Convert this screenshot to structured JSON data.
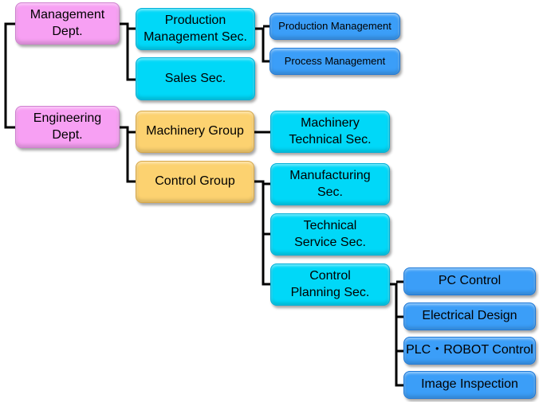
{
  "colors": {
    "department": "#f7a0f3",
    "section": "#00d8f8",
    "group": "#fcd270",
    "unit": "#3b9ef8",
    "connector": "#000000"
  },
  "departments": [
    {
      "label": "Management\nDept."
    },
    {
      "label": "Engineering\nDept."
    }
  ],
  "management": {
    "production_mgmt_sec": "Production\nManagement Sec.",
    "sales_sec": "Sales Sec.",
    "production_units": [
      "Production Management",
      "Process Management"
    ]
  },
  "engineering": {
    "machinery_group": "Machinery Group",
    "control_group": "Control Group",
    "machinery_technical_sec": "Machinery\nTechnical Sec.",
    "control_sections": [
      "Manufacturing\nSec.",
      "Technical\nService Sec.",
      "Control\nPlanning Sec."
    ],
    "control_planning_units": [
      "PC Control",
      "Electrical Design",
      "PLC・ROBOT Control",
      "Image Inspection"
    ]
  }
}
